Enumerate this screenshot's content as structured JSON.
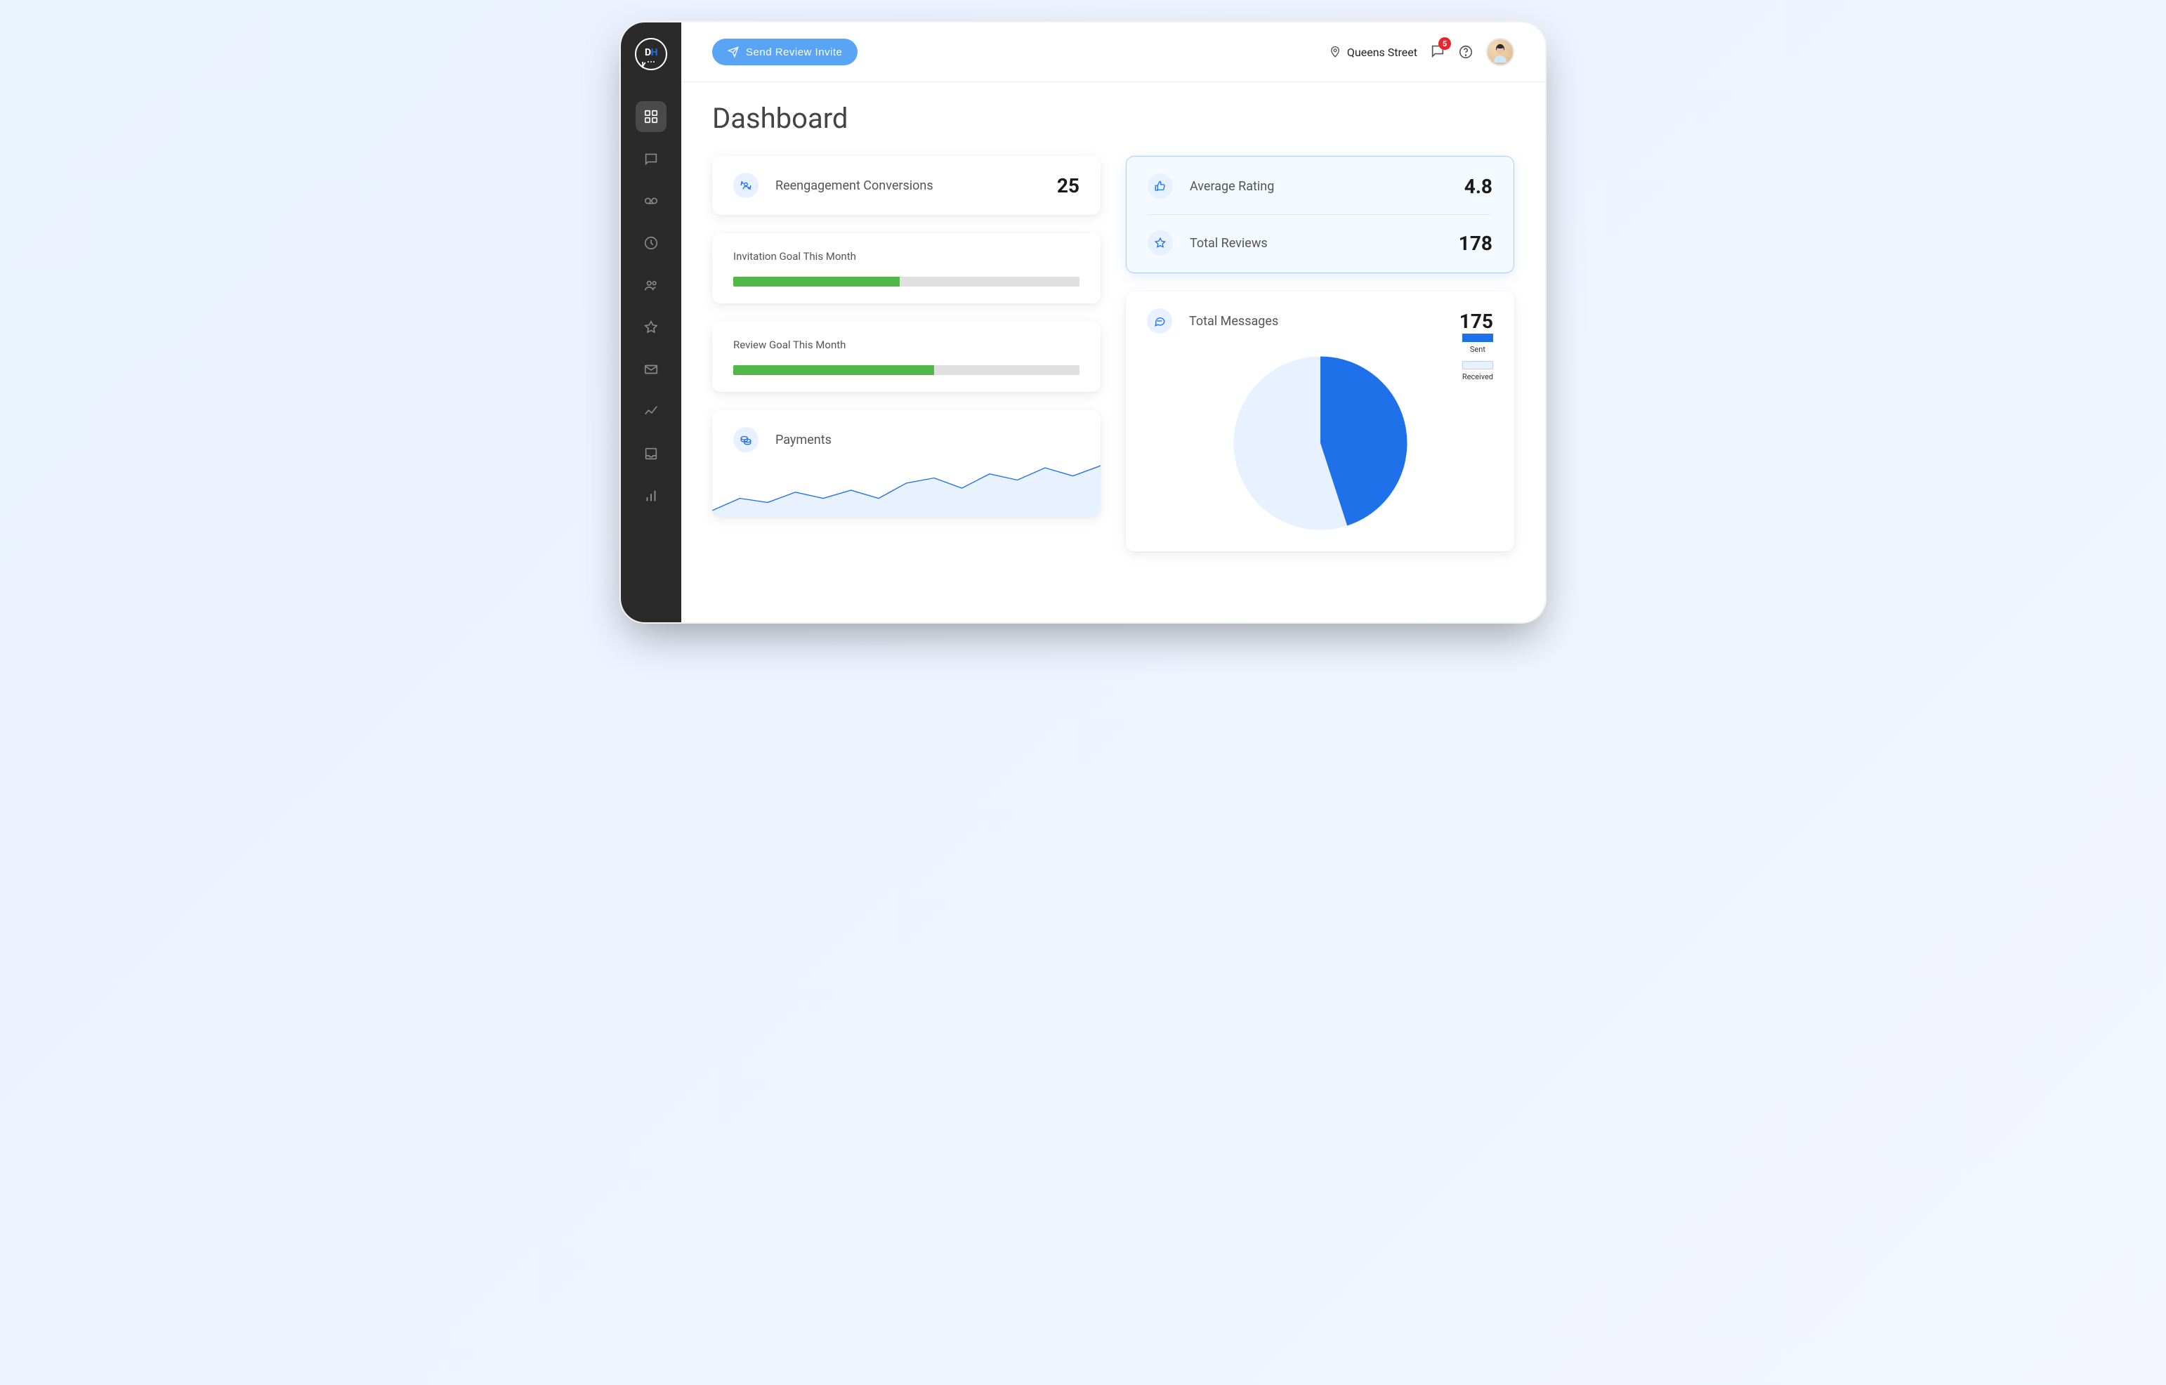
{
  "header": {
    "send_review_label": "Send Review Invite",
    "location": "Queens Street",
    "inbox_badge": "5"
  },
  "page": {
    "title": "Dashboard"
  },
  "stats": {
    "reengagement": {
      "label": "Reengagement Conversions",
      "value": "25"
    },
    "avg_rating": {
      "label": "Average Rating",
      "value": "4.8"
    },
    "total_reviews": {
      "label": "Total Reviews",
      "value": "178"
    },
    "total_messages": {
      "label": "Total Messages",
      "value": "175"
    }
  },
  "goals": {
    "invitation": {
      "label": "Invitation Goal This Month",
      "pct": 48
    },
    "review": {
      "label": "Review Goal This Month",
      "pct": 58
    }
  },
  "payments": {
    "label": "Payments"
  },
  "messages_legend": {
    "sent": "Sent",
    "received": "Received"
  },
  "chart_data": [
    {
      "type": "line",
      "title": "Payments",
      "x": [
        0,
        1,
        2,
        3,
        4,
        5,
        6,
        7,
        8,
        9,
        10,
        11,
        12,
        13,
        14
      ],
      "values": [
        18,
        30,
        26,
        36,
        30,
        38,
        30,
        45,
        50,
        40,
        54,
        48,
        60,
        52,
        62
      ]
    },
    {
      "type": "pie",
      "title": "Total Messages",
      "series": [
        {
          "name": "Sent",
          "value": 45,
          "color": "#1e71e8"
        },
        {
          "name": "Received",
          "value": 55,
          "color": "#e7f1ff"
        }
      ]
    }
  ]
}
